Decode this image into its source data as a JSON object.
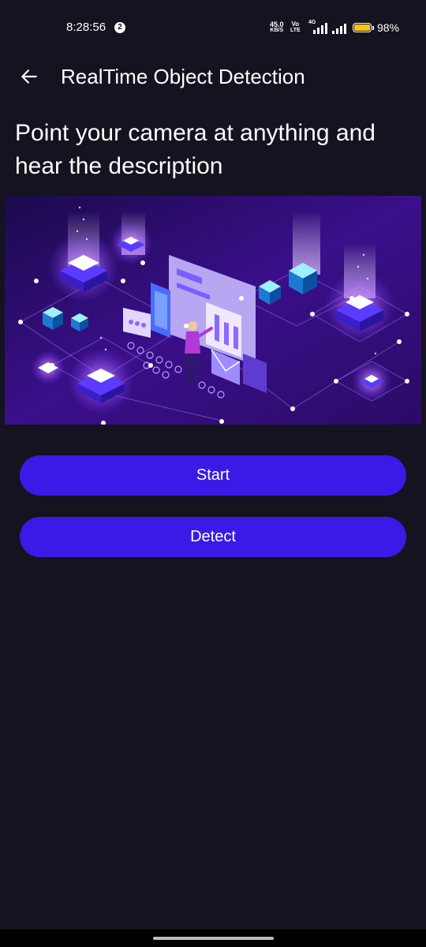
{
  "status_bar": {
    "time": "8:28:56",
    "notification_count": "2",
    "net_speed_value": "45.0",
    "net_speed_unit": "KB/S",
    "volte_top": "Vo",
    "volte_bottom": "LTE",
    "network_type": "4G",
    "battery_percent": "98%",
    "battery_level": 0.98
  },
  "app_bar": {
    "title": "RealTime Object Detection",
    "back_icon": "arrow-left-icon"
  },
  "main": {
    "headline": "Point your camera at anything and hear the description",
    "start_label": "Start",
    "detect_label": "Detect"
  },
  "colors": {
    "background": "#14131f",
    "button": "#3a1ae6",
    "battery": "#f5c518"
  }
}
